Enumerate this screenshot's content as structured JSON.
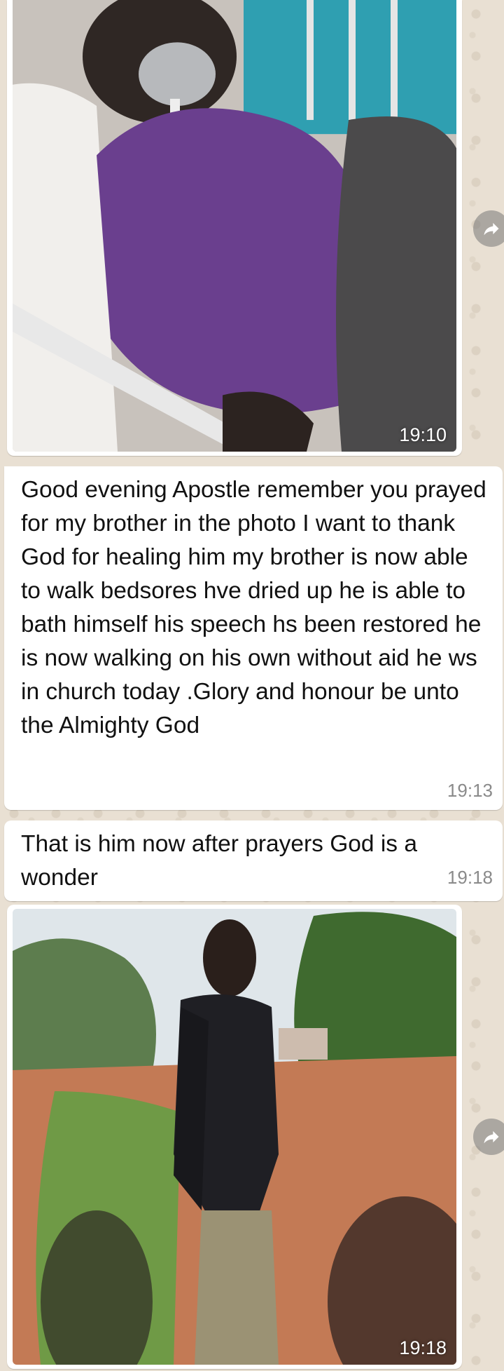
{
  "chat": {
    "messages": [
      {
        "type": "image",
        "description_icon": "photo-hospital",
        "time": "19:10"
      },
      {
        "type": "text",
        "text": "Good evening Apostle remember you prayed for my brother in the photo I want to thank God for healing him my brother is now able to walk bedsores hve dried up he is able to bath himself his speech hs been restored he is now walking on his own without aid he ws in church today .Glory and honour be unto the Almighty God",
        "time": "19:13"
      },
      {
        "type": "text",
        "text": "That is him now after prayers God is a wonder",
        "time": "19:18"
      },
      {
        "type": "image",
        "description_icon": "photo-outdoor",
        "time": "19:18"
      }
    ]
  },
  "icons": {
    "share": "forward-arrow-icon"
  },
  "colors": {
    "bubble": "#ffffff",
    "chat_background": "#e9e0d3",
    "timestamp": "#8a8a8a"
  }
}
